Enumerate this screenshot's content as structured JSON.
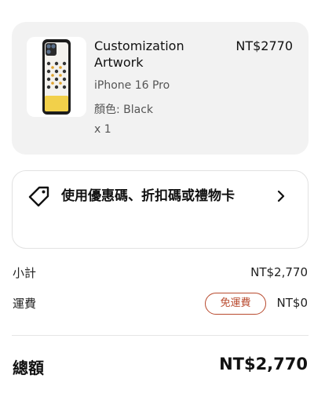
{
  "cart_item": {
    "name": "Customization Artwork",
    "price": "NT$2770",
    "model": "iPhone 16 Pro",
    "color": "顏色: Black",
    "quantity": "x 1",
    "thumbnail_icon": "phone-case-thumbnail"
  },
  "promo": {
    "label": "使用優惠碼、折扣碼或禮物卡",
    "icon": "tag-icon",
    "chevron": "chevron-right-icon"
  },
  "summary": {
    "subtotal_label": "小計",
    "subtotal_value": "NT$2,770",
    "shipping_label": "運費",
    "shipping_badge": "免運費",
    "shipping_value": "NT$0",
    "total_label": "總額",
    "total_value": "NT$2,770"
  },
  "colors": {
    "card_bg": "#f2f2f2",
    "badge_accent": "#b84a2e",
    "text": "#111111"
  }
}
